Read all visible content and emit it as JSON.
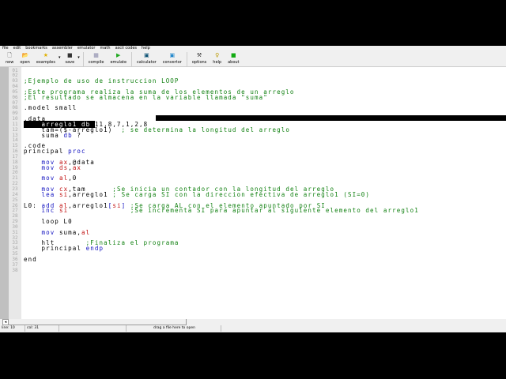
{
  "menu": [
    "file",
    "edit",
    "bookmarks",
    "assembler",
    "emulator",
    "math",
    "ascii codes",
    "help"
  ],
  "toolbar": [
    {
      "label": "new",
      "icon": "new-file-icon",
      "glyph": "🗋",
      "color": "#555"
    },
    {
      "label": "open",
      "icon": "open-folder-icon",
      "glyph": "📂",
      "color": "#a80"
    },
    {
      "label": "examples",
      "icon": "star-icon",
      "glyph": "★",
      "color": "#e0b000",
      "dropdown": true
    },
    {
      "label": "save",
      "icon": "floppy-icon",
      "glyph": "■",
      "color": "#333",
      "dropdown": true
    },
    {
      "label": "compile",
      "icon": "compile-icon",
      "glyph": "▦",
      "color": "#88a"
    },
    {
      "label": "emulate",
      "icon": "play-icon",
      "glyph": "▶",
      "color": "#2a2"
    },
    {
      "label": "calculator",
      "icon": "calculator-icon",
      "glyph": "▣",
      "color": "#157"
    },
    {
      "label": "convertor",
      "icon": "convertor-icon",
      "glyph": "▣",
      "color": "#28c"
    },
    {
      "label": "options",
      "icon": "tools-icon",
      "glyph": "⚒",
      "color": "#333"
    },
    {
      "label": "help",
      "icon": "help-key-icon",
      "glyph": "♀",
      "color": "#b90"
    },
    {
      "label": "about",
      "icon": "about-chip-icon",
      "glyph": "■",
      "color": "#1a1"
    }
  ],
  "code_lines": [
    [],
    [],
    [
      [
        ";Ejemplo de uso de instruccion LOOP",
        "c"
      ]
    ],
    [],
    [
      [
        ";Este programa realiza la suma de los elementos de un arreglo",
        "c"
      ]
    ],
    [
      [
        ";El resultado se almacena en la variable llamada \"suma\"",
        "c"
      ]
    ],
    [],
    [
      [
        ".model small",
        "t"
      ]
    ],
    [],
    [
      [
        ".data",
        "t"
      ]
    ],
    [
      [
        "    arreglo1 db ",
        "sel"
      ],
      [
        "11,8,7,1,2,8",
        "t"
      ]
    ],
    [
      [
        "    tam=($-arreglo1)  ",
        "t"
      ],
      [
        "; se determina la longitud del arreglo",
        "c"
      ]
    ],
    [
      [
        "    suma ",
        "t"
      ],
      [
        "db",
        "k"
      ],
      [
        " ?",
        "t"
      ]
    ],
    [],
    [
      [
        ".code",
        "t"
      ]
    ],
    [
      [
        "principal ",
        "t"
      ],
      [
        "proc",
        "k"
      ]
    ],
    [],
    [
      [
        "    ",
        "t"
      ],
      [
        "mov",
        "k"
      ],
      [
        " ",
        "t"
      ],
      [
        "ax",
        "r"
      ],
      [
        ",@data",
        "t"
      ]
    ],
    [
      [
        "    ",
        "t"
      ],
      [
        "mov",
        "k"
      ],
      [
        " ",
        "t"
      ],
      [
        "ds",
        "r"
      ],
      [
        ",",
        "t"
      ],
      [
        "ax",
        "r"
      ]
    ],
    [],
    [
      [
        "    ",
        "t"
      ],
      [
        "mov",
        "k"
      ],
      [
        " ",
        "t"
      ],
      [
        "al",
        "r"
      ],
      [
        ",0",
        "t"
      ]
    ],
    [],
    [
      [
        "    ",
        "t"
      ],
      [
        "mov",
        "k"
      ],
      [
        " ",
        "t"
      ],
      [
        "cx",
        "r"
      ],
      [
        ",tam      ",
        "t"
      ],
      [
        ";Se inicia un contador con la longitud del arreglo",
        "c"
      ]
    ],
    [
      [
        "    ",
        "t"
      ],
      [
        "lea",
        "k"
      ],
      [
        " ",
        "t"
      ],
      [
        "si",
        "r"
      ],
      [
        ",arreglo1 ",
        "t"
      ],
      [
        "; Se carga SI con la direccion efectiva de arreglo1 (SI=0)",
        "c"
      ]
    ],
    [],
    [
      [
        "L0: ",
        "t"
      ],
      [
        "add",
        "k"
      ],
      [
        " ",
        "t"
      ],
      [
        "al",
        "r"
      ],
      [
        ",arreglo1",
        "t"
      ],
      [
        "[",
        "k"
      ],
      [
        "si",
        "r"
      ],
      [
        "]",
        "k"
      ],
      [
        " ",
        "t"
      ],
      [
        ";Se carga AL con el elemento apuntado por SI",
        "c"
      ]
    ],
    [
      [
        "    ",
        "t"
      ],
      [
        "inc",
        "k"
      ],
      [
        " ",
        "t"
      ],
      [
        "si",
        "r"
      ],
      [
        "              ",
        "t"
      ],
      [
        ";Se incrementa SI para apuntar al siguiente elemento del arreglo1",
        "c"
      ]
    ],
    [],
    [
      [
        "    loop L0",
        "t"
      ]
    ],
    [],
    [
      [
        "    ",
        "t"
      ],
      [
        "mov",
        "k"
      ],
      [
        " suma,",
        "t"
      ],
      [
        "al",
        "r"
      ]
    ],
    [],
    [
      [
        "    hlt       ",
        "t"
      ],
      [
        ";Finaliza el programa",
        "c"
      ]
    ],
    [
      [
        "    principal ",
        "t"
      ],
      [
        "endp",
        "k"
      ]
    ],
    [],
    [
      [
        "end",
        "t"
      ]
    ],
    [],
    []
  ],
  "status": {
    "line": "line: 10",
    "col": "col: 31",
    "empty": "",
    "hint": "drag a file here to open"
  }
}
